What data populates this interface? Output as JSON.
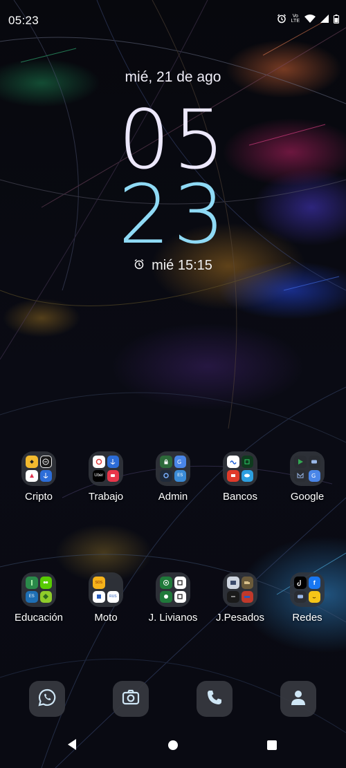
{
  "status_bar": {
    "time": "05:23",
    "icons": [
      "alarm-icon",
      "volte-lte-icon",
      "wifi-icon",
      "cell-signal-icon",
      "battery-icon"
    ],
    "volte_line1": "Vo",
    "volte_line2": "LTE"
  },
  "lock_clock": {
    "date": "mié, 21 de ago",
    "hours": "05",
    "minutes": "23",
    "next_alarm": "mié 15:15",
    "colors": {
      "hours": "#ece8fb",
      "minutes": "#8fdaf5"
    }
  },
  "folders": [
    {
      "label": "Cripto",
      "apps": [
        "binance-icon",
        "exchange-e-icon",
        "trade-icon",
        "anchor-icon"
      ]
    },
    {
      "label": "Trabajo",
      "apps": [
        "ring-icon",
        "anchor-icon",
        "uber-icon",
        "red-app-icon"
      ]
    },
    {
      "label": "Admin",
      "apps": [
        "lock-icon",
        "translate-icon",
        "settings-icon",
        "es-icon"
      ]
    },
    {
      "label": "Bancos",
      "apps": [
        "bank-wave-icon",
        "green-bank-icon",
        "red-bank-icon",
        "blue-bank-icon"
      ]
    },
    {
      "label": "Google",
      "apps": [
        "play-store-icon",
        "youtube-icon",
        "gmail-icon",
        "translate-icon"
      ]
    },
    {
      "label": "Educación",
      "apps": [
        "tree-icon",
        "duolingo-icon",
        "es-icon",
        "gem-icon"
      ]
    },
    {
      "label": "Moto",
      "apps": [
        "sos-icon",
        "blue-doc-icon",
        "rus-icon"
      ]
    },
    {
      "label": "J. Livianos",
      "apps": [
        "target-icon",
        "square-icon",
        "green-circle-icon",
        "square-icon"
      ]
    },
    {
      "label": "J.Pesados",
      "apps": [
        "photo-icon",
        "truck-icon",
        "dark-game-icon",
        "car-game-icon"
      ]
    },
    {
      "label": "Redes",
      "apps": [
        "tiktok-icon",
        "facebook-icon",
        "youtube-icon",
        "emoji-icon"
      ]
    }
  ],
  "mini_text": {
    "uber": "Uber",
    "sos": "SOS",
    "rus": "RUS",
    "es": "ES",
    "facebook": "f"
  },
  "dock": [
    "whatsapp-icon",
    "camera-icon",
    "phone-icon",
    "contacts-icon"
  ],
  "nav": [
    "back-button",
    "home-button",
    "recents-button"
  ]
}
